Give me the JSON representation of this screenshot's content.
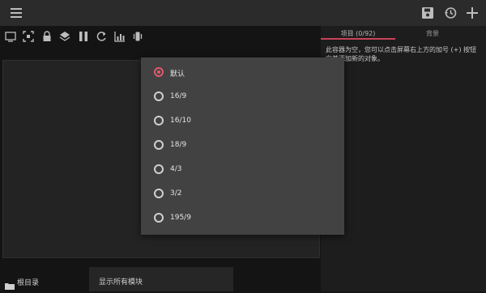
{
  "header": {
    "icons": [
      "menu-icon",
      "save-icon",
      "history-icon",
      "add-icon"
    ]
  },
  "toolbar": {
    "icons": [
      "preview-icon",
      "fit-icon",
      "lock-icon",
      "layers-icon",
      "pause-icon",
      "rotate-icon",
      "chart-icon",
      "vibrate-icon"
    ]
  },
  "right_panel": {
    "tabs": [
      {
        "label": "项目 (0/92)",
        "active": true
      },
      {
        "label": "背景",
        "active": false
      }
    ],
    "empty_message": "此容器为空，您可以点击屏幕右上方的加号 (+) 按钮向其添加新的对象。"
  },
  "footer": {
    "root_label": "根目录",
    "show_modules_label": "显示所有模块"
  },
  "dialog": {
    "options": [
      {
        "label": "默认",
        "selected": true
      },
      {
        "label": "16/9",
        "selected": false
      },
      {
        "label": "16/10",
        "selected": false
      },
      {
        "label": "18/9",
        "selected": false
      },
      {
        "label": "4/3",
        "selected": false
      },
      {
        "label": "3/2",
        "selected": false
      },
      {
        "label": "195/9",
        "selected": false
      }
    ]
  },
  "colors": {
    "accent": "#e05a6f",
    "dialog_bg": "#424242"
  }
}
